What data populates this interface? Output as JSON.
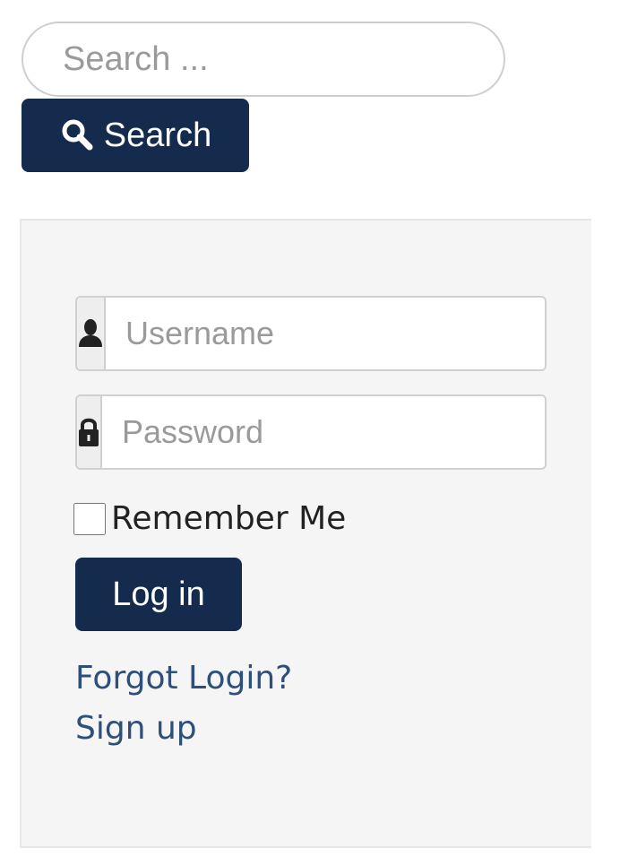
{
  "search": {
    "placeholder": "Search ...",
    "value": "",
    "button_label": "Search",
    "button_icon": "search-icon"
  },
  "login": {
    "username": {
      "placeholder": "Username",
      "value": "",
      "icon": "user-icon"
    },
    "password": {
      "placeholder": "Password",
      "value": "",
      "icon": "lock-icon"
    },
    "remember_label": "Remember Me",
    "remember_checked": false,
    "login_label": "Log in",
    "links": {
      "forgot": "Forgot Login?",
      "signup": "Sign up"
    }
  },
  "colors": {
    "button_bg": "#142b4e",
    "link": "#2e4f7a",
    "panel_bg": "#f5f5f5"
  }
}
